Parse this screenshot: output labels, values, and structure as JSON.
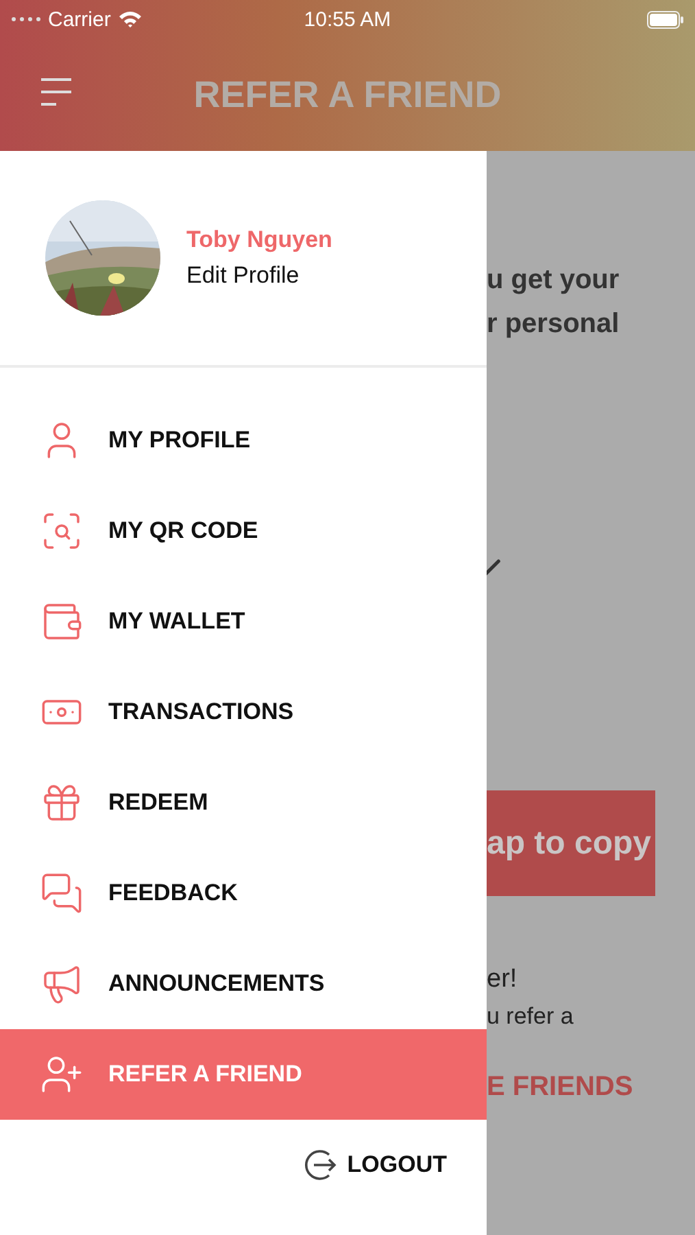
{
  "status_bar": {
    "carrier": "Carrier",
    "time": "10:55 AM"
  },
  "header": {
    "title": "REFER A FRIEND"
  },
  "drawer": {
    "profile": {
      "name": "Toby Nguyen",
      "link": "Edit Profile"
    },
    "items": [
      {
        "kind": "profile",
        "label": "MY PROFILE",
        "selected": false
      },
      {
        "kind": "qr",
        "label": "MY QR CODE",
        "selected": false
      },
      {
        "kind": "wallet",
        "label": "MY WALLET",
        "selected": false
      },
      {
        "kind": "transactions",
        "label": "TRANSACTIONS",
        "selected": false
      },
      {
        "kind": "redeem",
        "label": "REDEEM",
        "selected": false
      },
      {
        "kind": "feedback",
        "label": "FEEDBACK",
        "selected": false
      },
      {
        "kind": "announcements",
        "label": "ANNOUNCEMENTS",
        "selected": false
      },
      {
        "kind": "refer",
        "label": "REFER A FRIEND",
        "selected": true
      }
    ],
    "logout": "LOGOUT"
  },
  "background_page": {
    "intro_lines": [
      "u get your",
      "r personal"
    ],
    "copy_button": "ap to copy",
    "note_title": "er!",
    "note_text": "u refer a",
    "invite_link": "E FRIENDS"
  }
}
